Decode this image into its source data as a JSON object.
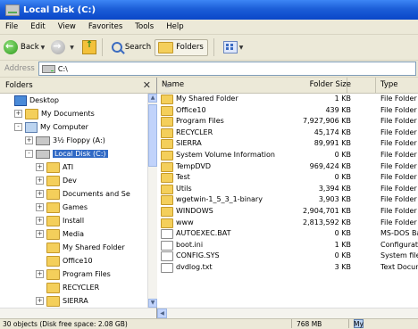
{
  "window": {
    "title": "Local Disk (C:)"
  },
  "menu": [
    "File",
    "Edit",
    "View",
    "Favorites",
    "Tools",
    "Help"
  ],
  "toolbar": {
    "back_label": "Back",
    "search_label": "Search",
    "folders_label": "Folders"
  },
  "address": {
    "label": "Address",
    "value": "C:\\"
  },
  "left_pane": {
    "title": "Folders",
    "tree": [
      {
        "label": "Desktop",
        "level": 0,
        "expander": "",
        "icon": "desktop-icon"
      },
      {
        "label": "My Documents",
        "level": 1,
        "expander": "+",
        "icon": "folder-icon"
      },
      {
        "label": "My Computer",
        "level": 1,
        "expander": "-",
        "icon": "my-computer-icon"
      },
      {
        "label": "3½ Floppy (A:)",
        "level": 2,
        "expander": "+",
        "icon": "floppy-icon"
      },
      {
        "label": "Local Disk (C:)",
        "level": 2,
        "expander": "-",
        "icon": "drive-icon",
        "selected": true
      },
      {
        "label": "ATI",
        "level": 3,
        "expander": "+",
        "icon": "folder-icon"
      },
      {
        "label": "Dev",
        "level": 3,
        "expander": "+",
        "icon": "folder-icon"
      },
      {
        "label": "Documents and Se",
        "level": 3,
        "expander": "+",
        "icon": "folder-icon"
      },
      {
        "label": "Games",
        "level": 3,
        "expander": "+",
        "icon": "folder-icon"
      },
      {
        "label": "Install",
        "level": 3,
        "expander": "+",
        "icon": "folder-icon"
      },
      {
        "label": "Media",
        "level": 3,
        "expander": "+",
        "icon": "folder-icon"
      },
      {
        "label": "My Shared Folder",
        "level": 3,
        "expander": "",
        "icon": "folder-icon"
      },
      {
        "label": "Office10",
        "level": 3,
        "expander": "",
        "icon": "folder-icon"
      },
      {
        "label": "Program Files",
        "level": 3,
        "expander": "+",
        "icon": "folder-icon"
      },
      {
        "label": "RECYCLER",
        "level": 3,
        "expander": "",
        "icon": "folder-icon"
      },
      {
        "label": "SIERRA",
        "level": 3,
        "expander": "+",
        "icon": "folder-icon"
      }
    ]
  },
  "columns": {
    "name": "Name",
    "size": "Folder Size",
    "type": "Type"
  },
  "files": [
    {
      "name": "My Shared Folder",
      "size": "1 KB",
      "type": "File Folder",
      "icon": "folder-icon"
    },
    {
      "name": "Office10",
      "size": "439 KB",
      "type": "File Folder",
      "icon": "folder-icon"
    },
    {
      "name": "Program Files",
      "size": "7,927,906 KB",
      "type": "File Folder",
      "icon": "folder-icon"
    },
    {
      "name": "RECYCLER",
      "size": "45,174 KB",
      "type": "File Folder",
      "icon": "folder-icon"
    },
    {
      "name": "SIERRA",
      "size": "89,991 KB",
      "type": "File Folder",
      "icon": "folder-icon"
    },
    {
      "name": "System Volume Information",
      "size": "0 KB",
      "type": "File Folder",
      "icon": "folder-icon"
    },
    {
      "name": "TempDVD",
      "size": "969,424 KB",
      "type": "File Folder",
      "icon": "folder-icon"
    },
    {
      "name": "Test",
      "size": "0 KB",
      "type": "File Folder",
      "icon": "folder-icon"
    },
    {
      "name": "Utils",
      "size": "3,394 KB",
      "type": "File Folder",
      "icon": "folder-icon"
    },
    {
      "name": "wgetwin-1_5_3_1-binary",
      "size": "3,903 KB",
      "type": "File Folder",
      "icon": "folder-icon"
    },
    {
      "name": "WINDOWS",
      "size": "2,904,701 KB",
      "type": "File Folder",
      "icon": "folder-icon"
    },
    {
      "name": "www",
      "size": "2,813,592 KB",
      "type": "File Folder",
      "icon": "folder-icon"
    },
    {
      "name": "AUTOEXEC.BAT",
      "size": "0 KB",
      "type": "MS-DOS Ba",
      "icon": "batch-file-icon"
    },
    {
      "name": "boot.ini",
      "size": "1 KB",
      "type": "Configurati",
      "icon": "config-file-icon"
    },
    {
      "name": "CONFIG.SYS",
      "size": "0 KB",
      "type": "System file",
      "icon": "system-file-icon"
    },
    {
      "name": "dvdlog.txt",
      "size": "3 KB",
      "type": "Text Docun",
      "icon": "text-file-icon"
    }
  ],
  "status": {
    "left": "30 objects (Disk free space: 2.08 GB)",
    "middle": "768 MB",
    "right": "My Compute"
  }
}
